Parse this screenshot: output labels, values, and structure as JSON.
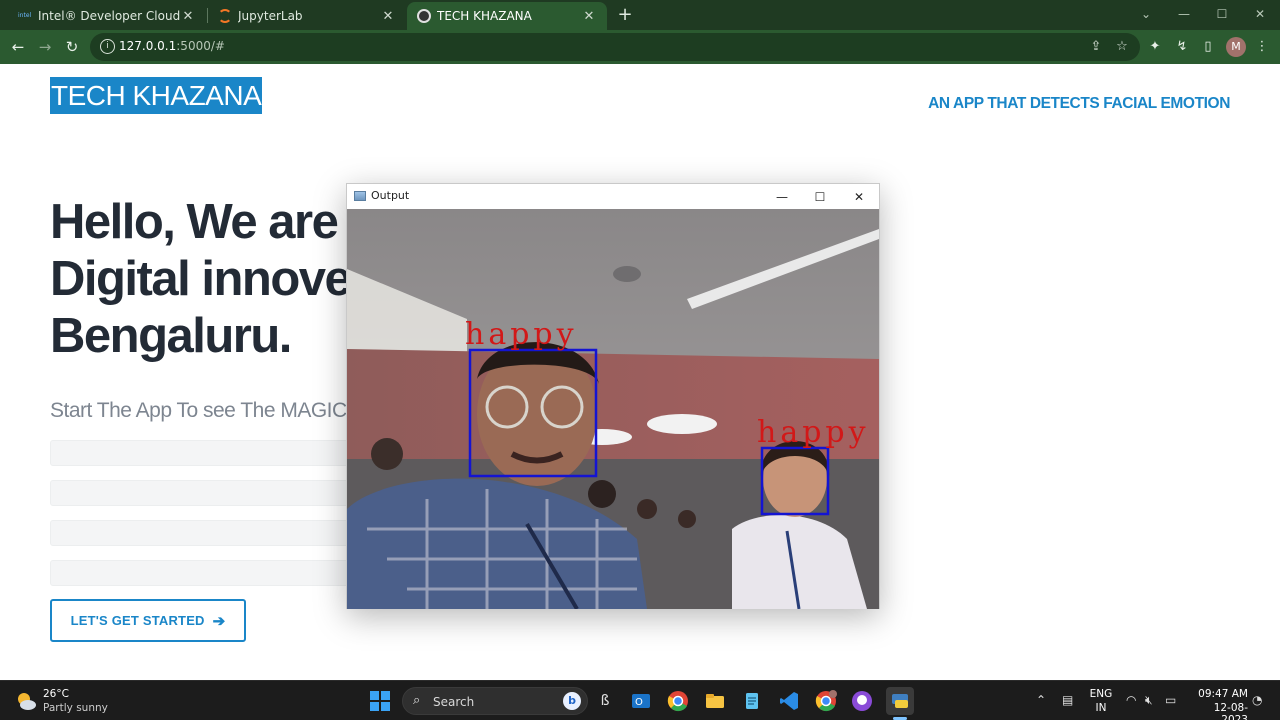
{
  "browser": {
    "tabs": [
      {
        "title": "Intel® Developer Cloud",
        "icon": "intel-favicon",
        "active": false
      },
      {
        "title": "JupyterLab",
        "icon": "jupyter-favicon",
        "active": false
      },
      {
        "title": "TECH KHAZANA",
        "icon": "site-favicon",
        "active": true
      }
    ],
    "url_host": "127.0.0.1",
    "url_path": ":5000/#",
    "new_tab_glyph": "+",
    "avatar_initial": "M"
  },
  "site": {
    "logo": "TECH KHAZANA",
    "tagline": "AN APP THAT DETECTS FACIAL EMOTION",
    "hero_lines": [
      "Hello, We are",
      "Digital innove",
      "Bengaluru."
    ],
    "subtitle": "Start The App To see The MAGIC",
    "cta_label": "LET'S GET STARTED",
    "cta_icon": "arrow-right-icon"
  },
  "output_window": {
    "title": "Output",
    "detections": [
      {
        "label": "happy"
      },
      {
        "label": "happy"
      }
    ]
  },
  "taskbar": {
    "weather_temp": "26°C",
    "weather_condition": "Partly sunny",
    "search_placeholder": "Search",
    "language_line1": "ENG",
    "language_line2": "IN",
    "time": "09:47 AM",
    "date": "12-08-2023"
  },
  "colors": {
    "accent": "#1a86c8",
    "chrome_dark": "#1f3a22",
    "chrome_toolbar": "#2b5a30",
    "box_color": "#1414d2",
    "label_color": "#d21818"
  }
}
